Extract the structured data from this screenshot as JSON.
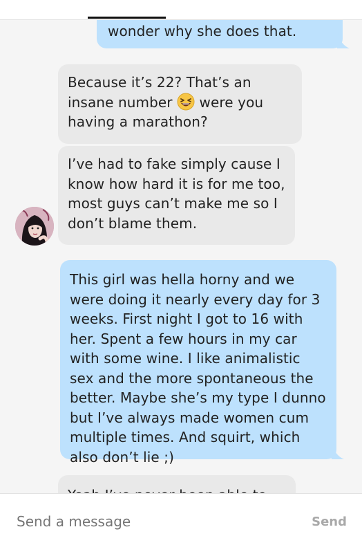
{
  "conversation": {
    "messages": [
      {
        "id": "m1",
        "direction": "outgoing",
        "text": "wonder why she does that."
      },
      {
        "id": "m2",
        "direction": "incoming",
        "text_before_emoji": "Because it’s 22? That’s an insane number ",
        "emoji": "laughing-face-emoji",
        "text_after_emoji": " were you having a marathon?"
      },
      {
        "id": "m3",
        "direction": "incoming",
        "text": "I’ve had to fake simply cause I know how hard it is for me too, most guys can’t make me so I don’t blame them."
      },
      {
        "id": "m4",
        "direction": "outgoing",
        "text": "This girl was hella horny and we were doing it nearly every day for 3 weeks. First night I got to 16 with her. Spent a few hours in my car with some wine. I like animalistic sex and the more spontaneous the better. Maybe she’s my type I dunno but I’ve always made women cum multiple times. And squirt, which also don’t lie ;)"
      },
      {
        "id": "m5",
        "direction": "incoming",
        "text": "Yeah I’ve never been able to do"
      }
    ]
  },
  "composer": {
    "placeholder": "Send a message",
    "send_label": "Send"
  },
  "colors": {
    "outgoing_bubble": "#bde1fd",
    "incoming_bubble": "#e9e9e9",
    "background": "#f5f5f5"
  }
}
